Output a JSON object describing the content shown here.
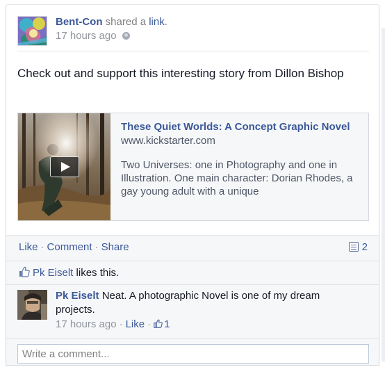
{
  "post": {
    "author": "Bent-Con",
    "action_prefix": "shared a",
    "action_link": "link",
    "action_suffix": ".",
    "timestamp": "17 hours ago",
    "privacy_icon": "globe-icon",
    "message": "Check out and support this interesting story from Dillon Bishop"
  },
  "link_preview": {
    "title": "These Quiet Worlds: A Concept Graphic Novel",
    "domain": "www.kickstarter.com",
    "description": "Two Universes: one in Photography and one in Illustration. One main character: Dorian Rhodes, a gay young adult with a unique",
    "play_icon": "play-icon"
  },
  "actions": {
    "like": "Like",
    "comment": "Comment",
    "share": "Share",
    "comment_count": "2"
  },
  "likes": {
    "name": "Pk Eiselt",
    "text": "likes this."
  },
  "comment": {
    "author": "Pk Eiselt",
    "text": "Neat. A photographic Novel is one of my dream projects.",
    "timestamp": "17 hours ago",
    "like_label": "Like",
    "like_count": "1"
  },
  "composer": {
    "placeholder": "Write a comment..."
  },
  "colors": {
    "link": "#3b5998",
    "muted": "#90949c",
    "ufi_background": "#f6f7f9",
    "border": "#d3d6db"
  }
}
